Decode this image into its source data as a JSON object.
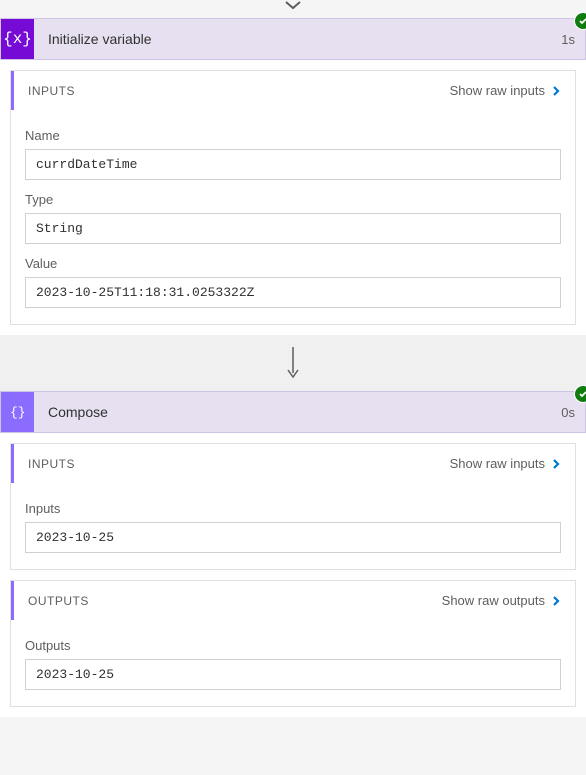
{
  "actions": {
    "initVar": {
      "icon": "{x}",
      "title": "Initialize variable",
      "duration": "1s",
      "inputs": {
        "headerLabel": "INPUTS",
        "showLink": "Show raw inputs",
        "fields": {
          "name": {
            "label": "Name",
            "value": "currdDateTime"
          },
          "type": {
            "label": "Type",
            "value": "String"
          },
          "value": {
            "label": "Value",
            "value": "2023-10-25T11:18:31.0253322Z"
          }
        }
      }
    },
    "compose": {
      "icon": "{∅}",
      "title": "Compose",
      "duration": "0s",
      "inputs": {
        "headerLabel": "INPUTS",
        "showLink": "Show raw inputs",
        "fields": {
          "inputs": {
            "label": "Inputs",
            "value": "2023-10-25"
          }
        }
      },
      "outputs": {
        "headerLabel": "OUTPUTS",
        "showLink": "Show raw outputs",
        "fields": {
          "outputs": {
            "label": "Outputs",
            "value": "2023-10-25"
          }
        }
      }
    }
  }
}
